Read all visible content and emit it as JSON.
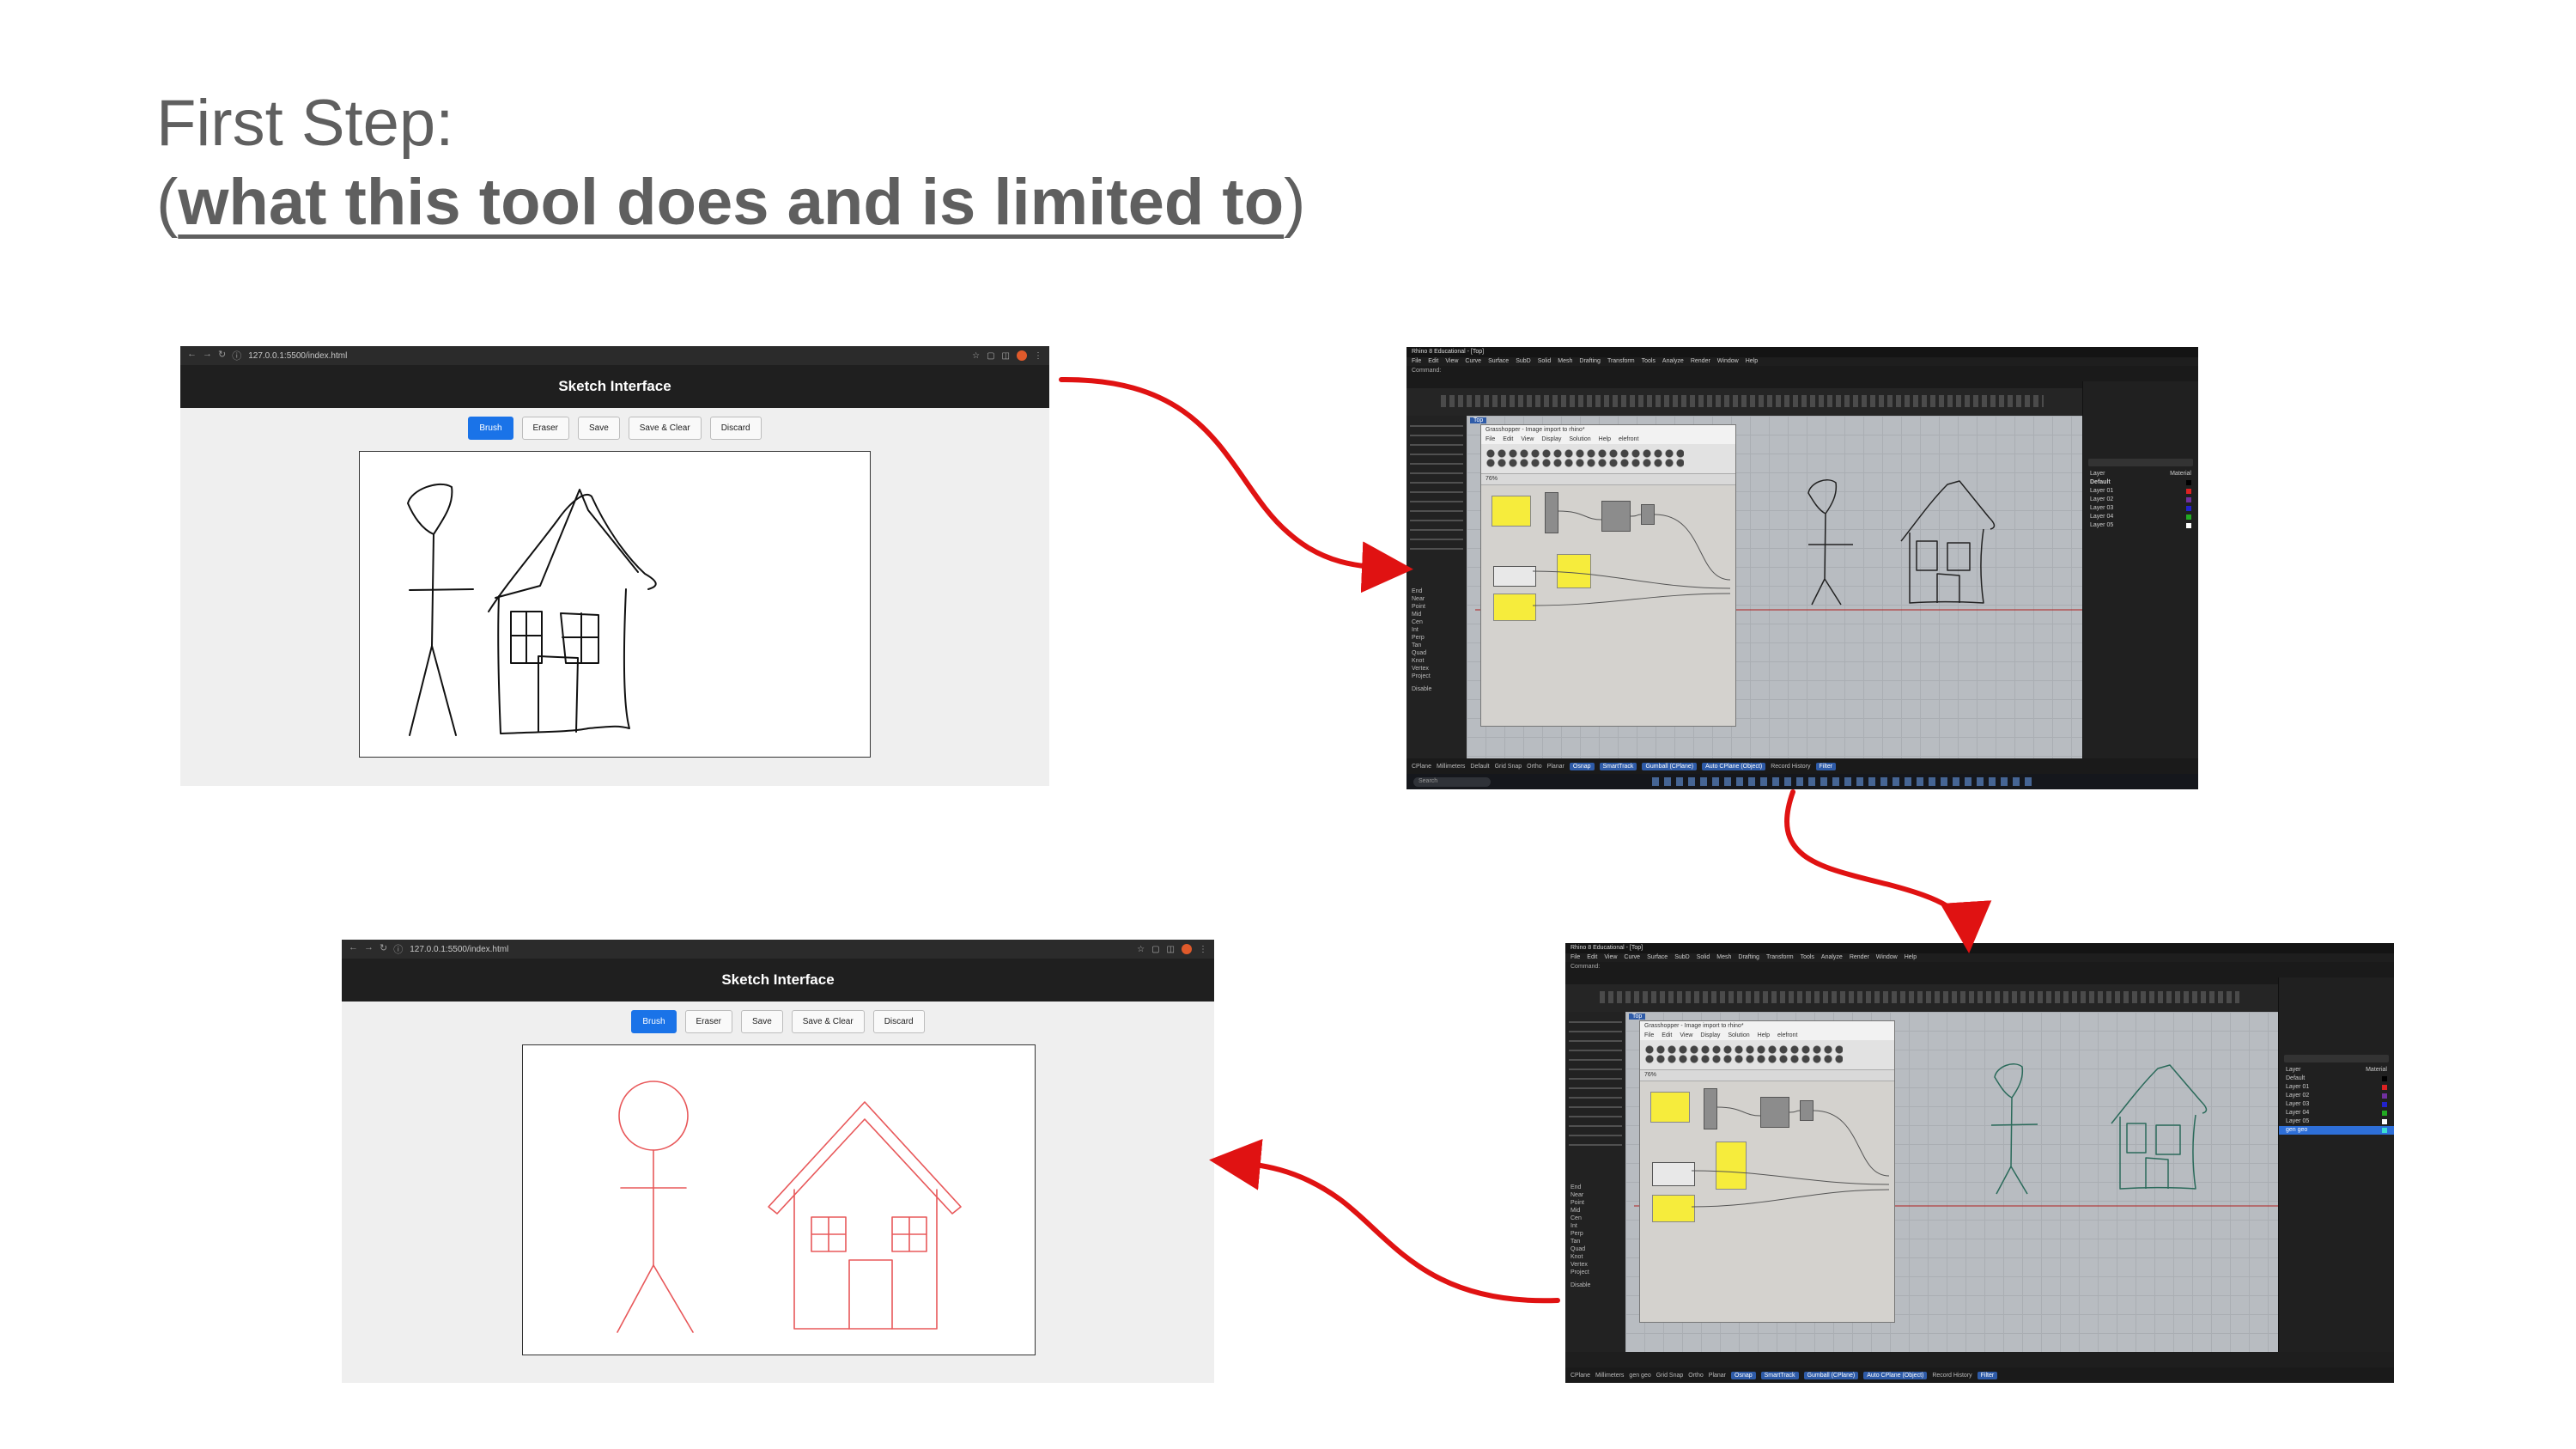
{
  "slide": {
    "title_line1": "First Step:",
    "title_paren_open": "(",
    "title_line2": "what this tool does and is limited to",
    "title_paren_close": ")"
  },
  "browser_top": {
    "url": "127.0.0.1:5500/index.html",
    "app_title": "Sketch Interface",
    "buttons": [
      "Brush",
      "Eraser",
      "Save",
      "Save & Clear",
      "Discard"
    ],
    "active_button": "Brush"
  },
  "browser_bottom": {
    "url": "127.0.0.1:5500/index.html",
    "app_title": "Sketch Interface",
    "buttons": [
      "Brush",
      "Eraser",
      "Save",
      "Save & Clear",
      "Discard"
    ],
    "active_button": "Brush"
  },
  "rhino_top": {
    "window_title": "Rhino 8 Educational - [Top]",
    "menu": [
      "File",
      "Edit",
      "View",
      "Curve",
      "Surface",
      "SubD",
      "Solid",
      "Mesh",
      "Drafting",
      "Transform",
      "Tools",
      "Analyze",
      "Render",
      "Window",
      "Help"
    ],
    "command_label": "Command:",
    "viewport_tab": "Top",
    "gh_title": "Grasshopper - Image import to rhino*",
    "gh_menu": [
      "File",
      "Edit",
      "View",
      "Display",
      "Solution",
      "Help",
      "elefront"
    ],
    "gh_zoom": "76%",
    "osnaps": [
      "End",
      "Near",
      "Point",
      "Mid",
      "Cen",
      "Int",
      "Perp",
      "Tan",
      "Quad",
      "Knot",
      "Vertex",
      "Project",
      "Disable"
    ],
    "layers": [
      "Default",
      "Layer 01",
      "Layer 02",
      "Layer 03",
      "Layer 04",
      "Layer 05"
    ],
    "layers_header": [
      "Layer",
      "Material"
    ],
    "status": [
      "CPlane",
      "Millimeters",
      "Default",
      "Grid Snap",
      "Ortho",
      "Planar",
      "Osnap",
      "SmartTrack",
      "Gumball (CPlane)",
      "Auto CPlane (Object)",
      "Record History",
      "Filter"
    ],
    "taskbar_search": "Search"
  },
  "rhino_bottom": {
    "window_title": "Rhino 8 Educational - [Top]",
    "menu": [
      "File",
      "Edit",
      "View",
      "Curve",
      "Surface",
      "SubD",
      "Solid",
      "Mesh",
      "Drafting",
      "Transform",
      "Tools",
      "Analyze",
      "Render",
      "Window",
      "Help"
    ],
    "command_label": "Command:",
    "viewport_tab": "Top",
    "gh_title": "Grasshopper - Image import to rhino*",
    "gh_menu": [
      "File",
      "Edit",
      "View",
      "Display",
      "Solution",
      "Help",
      "elefront"
    ],
    "gh_zoom": "76%",
    "osnaps": [
      "End",
      "Near",
      "Point",
      "Mid",
      "Cen",
      "Int",
      "Perp",
      "Tan",
      "Quad",
      "Knot",
      "Vertex",
      "Project",
      "Disable"
    ],
    "layers": [
      "Default",
      "Layer 01",
      "Layer 02",
      "Layer 03",
      "Layer 04",
      "Layer 05",
      "gen geo"
    ],
    "layers_header": [
      "Layer",
      "Material"
    ],
    "status": [
      "CPlane",
      "Millimeters",
      "gen geo",
      "Grid Snap",
      "Ortho",
      "Planar",
      "Osnap",
      "SmartTrack",
      "Gumball (CPlane)",
      "Auto CPlane (Object)",
      "Record History",
      "Filter"
    ]
  },
  "colors": {
    "title_gray": "#5f5f5f",
    "arrow_red": "#e01212",
    "sketch_black": "#111111",
    "generated_red": "#e8585a",
    "active_blue": "#1a73e8"
  },
  "icons": [
    "back-icon",
    "forward-icon",
    "reload-icon",
    "info-icon",
    "star-icon",
    "extension-icon",
    "menu-icon",
    "flow-arrow"
  ]
}
